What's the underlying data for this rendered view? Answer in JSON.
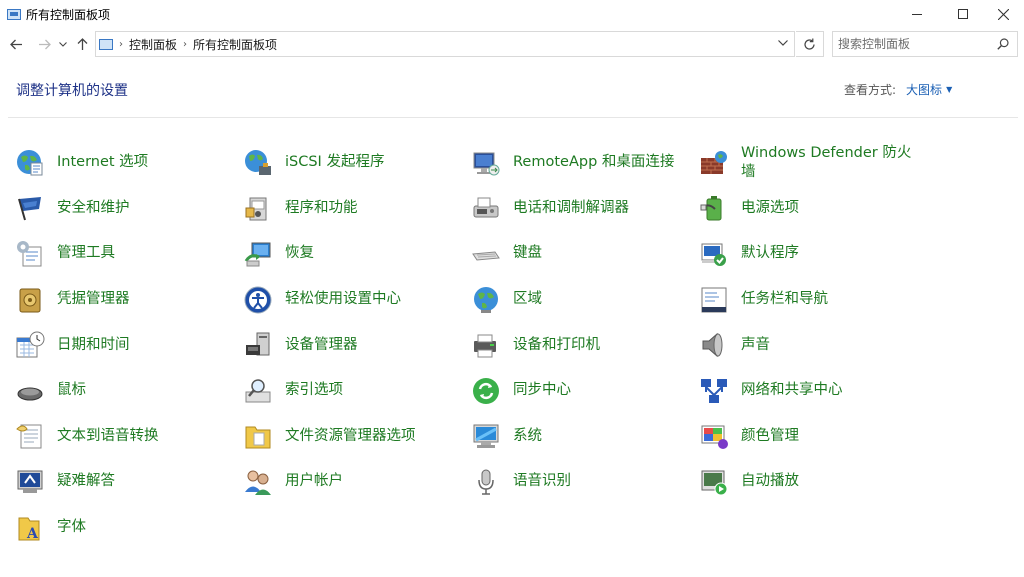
{
  "window": {
    "title": "所有控制面板项",
    "minimize_icon": "minimize-icon",
    "maximize_icon": "maximize-icon",
    "close_icon": "close-icon"
  },
  "navigation": {
    "back_icon": "back-arrow-icon",
    "forward_icon": "forward-arrow-icon",
    "recent_icon": "chevron-down-icon",
    "up_icon": "up-arrow-icon",
    "breadcrumbs": [
      "控制面板",
      "所有控制面板项"
    ],
    "refresh_icon": "refresh-icon"
  },
  "search": {
    "placeholder": "搜索控制面板"
  },
  "header": {
    "title": "调整计算机的设置",
    "view_by_label": "查看方式:",
    "view_by_value": "大图标"
  },
  "colors": {
    "link_green": "#1e7a22",
    "heading_blue": "#1e3287",
    "accent_blue": "#1a5fb4"
  },
  "items": [
    {
      "label": "Internet 选项",
      "icon": "globe-icon"
    },
    {
      "label": "iSCSI 发起程序",
      "icon": "iscsi-globe-icon"
    },
    {
      "label": "RemoteApp 和桌面连接",
      "icon": "remote-desktop-icon"
    },
    {
      "label": "Windows Defender 防火墙",
      "icon": "firewall-icon"
    },
    {
      "label": "安全和维护",
      "icon": "flag-icon"
    },
    {
      "label": "程序和功能",
      "icon": "programs-icon"
    },
    {
      "label": "电话和调制解调器",
      "icon": "fax-icon"
    },
    {
      "label": "电源选项",
      "icon": "battery-icon"
    },
    {
      "label": "管理工具",
      "icon": "admin-tools-icon"
    },
    {
      "label": "恢复",
      "icon": "recovery-icon"
    },
    {
      "label": "键盘",
      "icon": "keyboard-icon"
    },
    {
      "label": "默认程序",
      "icon": "default-programs-icon"
    },
    {
      "label": "凭据管理器",
      "icon": "vault-icon"
    },
    {
      "label": "轻松使用设置中心",
      "icon": "ease-of-access-icon"
    },
    {
      "label": "区域",
      "icon": "region-globe-icon"
    },
    {
      "label": "任务栏和导航",
      "icon": "taskbar-icon"
    },
    {
      "label": "日期和时间",
      "icon": "calendar-clock-icon"
    },
    {
      "label": "设备管理器",
      "icon": "device-manager-icon"
    },
    {
      "label": "设备和打印机",
      "icon": "printer-icon"
    },
    {
      "label": "声音",
      "icon": "speaker-icon"
    },
    {
      "label": "鼠标",
      "icon": "mouse-icon"
    },
    {
      "label": "索引选项",
      "icon": "indexing-icon"
    },
    {
      "label": "同步中心",
      "icon": "sync-icon"
    },
    {
      "label": "网络和共享中心",
      "icon": "network-icon"
    },
    {
      "label": "文本到语音转换",
      "icon": "text-to-speech-icon"
    },
    {
      "label": "文件资源管理器选项",
      "icon": "folder-options-icon"
    },
    {
      "label": "系统",
      "icon": "system-monitor-icon"
    },
    {
      "label": "颜色管理",
      "icon": "color-management-icon"
    },
    {
      "label": "疑难解答",
      "icon": "troubleshoot-icon"
    },
    {
      "label": "用户帐户",
      "icon": "user-accounts-icon"
    },
    {
      "label": "语音识别",
      "icon": "microphone-icon"
    },
    {
      "label": "自动播放",
      "icon": "autoplay-icon"
    },
    {
      "label": "字体",
      "icon": "fonts-icon"
    }
  ]
}
